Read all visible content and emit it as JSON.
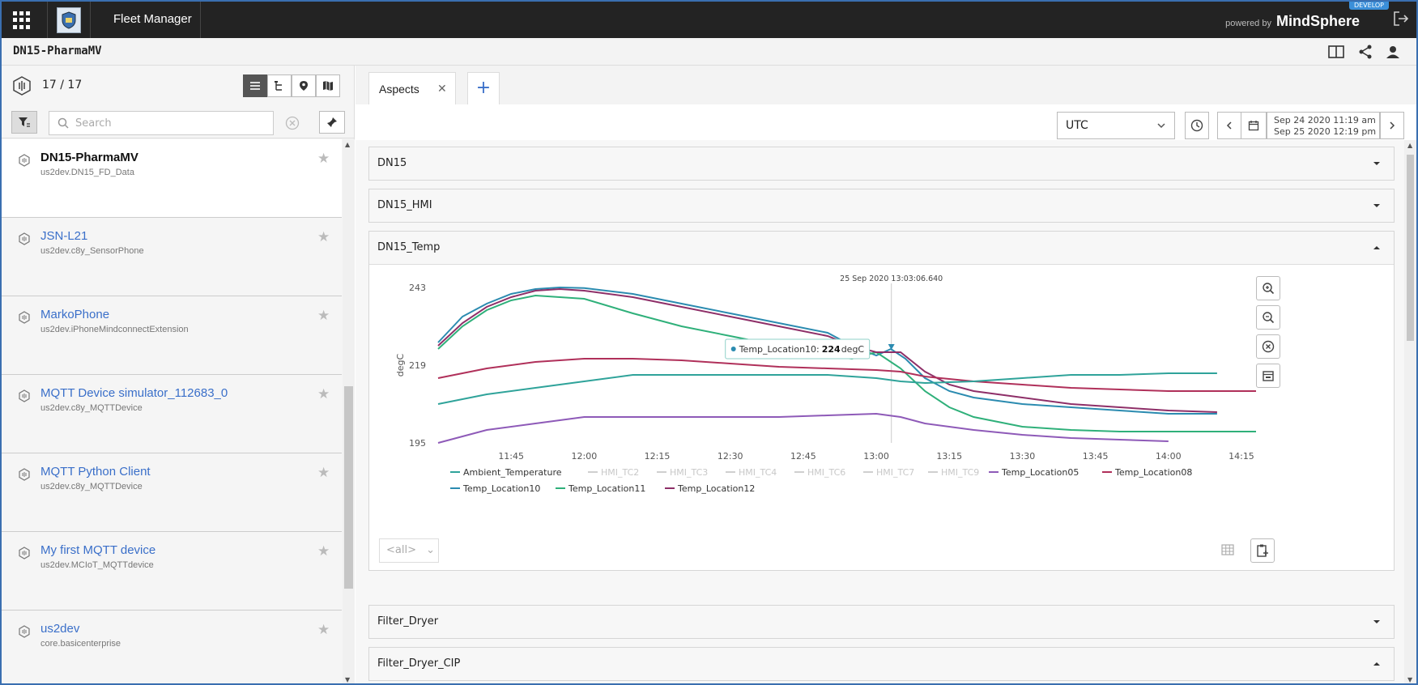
{
  "app": {
    "title": "Fleet Manager",
    "powered_small": "powered by",
    "powered_brand": "MindSphere",
    "env_badge": "DEVELOP"
  },
  "subbar": {
    "asset_title": "DN15-PharmaMV"
  },
  "left": {
    "count": "17 / 17",
    "search_placeholder": "Search",
    "assets": [
      {
        "name": "DN15-PharmaMV",
        "sub": "us2dev.DN15_FD_Data",
        "selected": true
      },
      {
        "name": "JSN-L21",
        "sub": "us2dev.c8y_SensorPhone"
      },
      {
        "name": "MarkoPhone",
        "sub": "us2dev.iPhoneMindconnectExtension"
      },
      {
        "name": "MQTT Device simulator_112683_0",
        "sub": "us2dev.c8y_MQTTDevice"
      },
      {
        "name": "MQTT Python Client",
        "sub": "us2dev.c8y_MQTTDevice"
      },
      {
        "name": "My first MQTT device",
        "sub": "us2dev.MCIoT_MQTTdevice"
      },
      {
        "name": "us2dev",
        "sub": "core.basicenterprise"
      }
    ]
  },
  "tabs": {
    "aspects_label": "Aspects"
  },
  "toolbar": {
    "timezone": "UTC",
    "date_from": "Sep 24 2020 11:19 am",
    "date_to": "Sep 25 2020 12:19 pm"
  },
  "sections": {
    "dn15": "DN15",
    "dn15_hmi": "DN15_HMI",
    "dn15_temp": "DN15_Temp",
    "filter_dryer": "Filter_Dryer",
    "filter_dryer_cip": "Filter_Dryer_CIP"
  },
  "chart_filter": "<all>",
  "colors": {
    "teal": "#2fa39a",
    "blue_teal": "#2b8bb0",
    "green": "#2fb07a",
    "purple": "#8e5ab8",
    "crimson": "#b0305a",
    "disabled": "#cfcfcf"
  },
  "chart_data": {
    "type": "line",
    "ylabel": "degC",
    "yticks": [
      195,
      219,
      243
    ],
    "ylim": [
      195,
      243
    ],
    "xticks": [
      "11:45",
      "12:00",
      "12:15",
      "12:30",
      "12:45",
      "13:00",
      "13:15",
      "13:30",
      "13:45",
      "14:00",
      "14:15"
    ],
    "xrange_minutes": [
      690,
      858
    ],
    "cursor_label": "25 Sep 2020 13:03:06.640",
    "cursor_minute": 783.1,
    "tooltip": {
      "series": "Temp_Location10:",
      "value": "224",
      "unit": "degC"
    },
    "legend": [
      {
        "name": "Ambient_Temperature",
        "color": "#2fa39a",
        "active": true
      },
      {
        "name": "HMI_TC2",
        "color": "#cfcfcf",
        "active": false
      },
      {
        "name": "HMI_TC3",
        "color": "#cfcfcf",
        "active": false
      },
      {
        "name": "HMI_TC4",
        "color": "#cfcfcf",
        "active": false
      },
      {
        "name": "HMI_TC6",
        "color": "#cfcfcf",
        "active": false
      },
      {
        "name": "HMI_TC7",
        "color": "#cfcfcf",
        "active": false
      },
      {
        "name": "HMI_TC9",
        "color": "#cfcfcf",
        "active": false
      },
      {
        "name": "Temp_Location05",
        "color": "#8e5ab8",
        "active": true
      },
      {
        "name": "Temp_Location08",
        "color": "#b0305a",
        "active": true
      },
      {
        "name": "Temp_Location10",
        "color": "#2b8bb0",
        "active": true
      },
      {
        "name": "Temp_Location11",
        "color": "#2fb07a",
        "active": true
      },
      {
        "name": "Temp_Location12",
        "color": "#8e2f68",
        "active": true
      }
    ],
    "series": [
      {
        "name": "Temp_Location10",
        "color": "#2b8bb0",
        "points": [
          [
            690,
            226
          ],
          [
            695,
            234
          ],
          [
            700,
            238
          ],
          [
            705,
            241
          ],
          [
            710,
            242.5
          ],
          [
            715,
            243
          ],
          [
            720,
            242.8
          ],
          [
            730,
            241
          ],
          [
            740,
            238
          ],
          [
            750,
            235
          ],
          [
            760,
            232
          ],
          [
            770,
            229
          ],
          [
            775,
            225
          ],
          [
            780,
            222
          ],
          [
            783,
            224
          ],
          [
            786,
            221
          ],
          [
            790,
            215
          ],
          [
            795,
            211
          ],
          [
            800,
            209
          ],
          [
            810,
            207
          ],
          [
            820,
            206
          ],
          [
            830,
            205
          ],
          [
            840,
            204
          ],
          [
            850,
            204
          ]
        ]
      },
      {
        "name": "Temp_Location11",
        "color": "#2fb07a",
        "points": [
          [
            690,
            224
          ],
          [
            695,
            231
          ],
          [
            700,
            236
          ],
          [
            705,
            239
          ],
          [
            710,
            240.5
          ],
          [
            715,
            240
          ],
          [
            720,
            239.5
          ],
          [
            730,
            235
          ],
          [
            740,
            231
          ],
          [
            750,
            228
          ],
          [
            760,
            225
          ],
          [
            770,
            222
          ],
          [
            775,
            221
          ],
          [
            780,
            223
          ],
          [
            785,
            218
          ],
          [
            790,
            211
          ],
          [
            795,
            206
          ],
          [
            800,
            203
          ],
          [
            810,
            200
          ],
          [
            820,
            199
          ],
          [
            830,
            198.5
          ],
          [
            840,
            198.5
          ],
          [
            850,
            198.5
          ],
          [
            858,
            198.5
          ]
        ]
      },
      {
        "name": "Temp_Location12",
        "color": "#8e2f68",
        "points": [
          [
            690,
            225
          ],
          [
            695,
            232
          ],
          [
            700,
            237
          ],
          [
            705,
            240
          ],
          [
            710,
            242
          ],
          [
            715,
            242.5
          ],
          [
            720,
            242
          ],
          [
            730,
            240
          ],
          [
            740,
            237
          ],
          [
            750,
            234
          ],
          [
            760,
            231
          ],
          [
            770,
            228
          ],
          [
            775,
            225
          ],
          [
            780,
            223
          ],
          [
            785,
            223
          ],
          [
            790,
            217
          ],
          [
            795,
            213
          ],
          [
            800,
            211
          ],
          [
            810,
            209
          ],
          [
            820,
            207
          ],
          [
            830,
            206
          ],
          [
            840,
            205
          ],
          [
            850,
            204.5
          ]
        ]
      },
      {
        "name": "Temp_Location08",
        "color": "#b0305a",
        "points": [
          [
            690,
            215
          ],
          [
            700,
            218
          ],
          [
            710,
            220
          ],
          [
            720,
            221
          ],
          [
            730,
            221
          ],
          [
            740,
            220.5
          ],
          [
            750,
            219.5
          ],
          [
            760,
            218.5
          ],
          [
            770,
            218
          ],
          [
            780,
            217.5
          ],
          [
            785,
            217
          ],
          [
            790,
            215.5
          ],
          [
            800,
            214
          ],
          [
            810,
            213
          ],
          [
            820,
            212
          ],
          [
            830,
            211.5
          ],
          [
            840,
            211
          ],
          [
            850,
            211
          ],
          [
            858,
            211
          ]
        ]
      },
      {
        "name": "Ambient_Temperature",
        "color": "#2fa39a",
        "points": [
          [
            690,
            207
          ],
          [
            700,
            210
          ],
          [
            710,
            212
          ],
          [
            720,
            214
          ],
          [
            730,
            216
          ],
          [
            740,
            216
          ],
          [
            750,
            216
          ],
          [
            760,
            216
          ],
          [
            770,
            216
          ],
          [
            780,
            215
          ],
          [
            785,
            214
          ],
          [
            790,
            213.5
          ],
          [
            800,
            214
          ],
          [
            810,
            215
          ],
          [
            820,
            216
          ],
          [
            830,
            216
          ],
          [
            840,
            216.5
          ],
          [
            850,
            216.5
          ]
        ]
      },
      {
        "name": "Temp_Location05",
        "color": "#8e5ab8",
        "points": [
          [
            690,
            195
          ],
          [
            700,
            199
          ],
          [
            710,
            201
          ],
          [
            720,
            203
          ],
          [
            730,
            203
          ],
          [
            740,
            203
          ],
          [
            750,
            203
          ],
          [
            760,
            203
          ],
          [
            770,
            203.5
          ],
          [
            780,
            204
          ],
          [
            785,
            203
          ],
          [
            790,
            201
          ],
          [
            800,
            199
          ],
          [
            810,
            197.5
          ],
          [
            820,
            196.5
          ],
          [
            830,
            196
          ],
          [
            840,
            195.5
          ]
        ]
      }
    ]
  }
}
